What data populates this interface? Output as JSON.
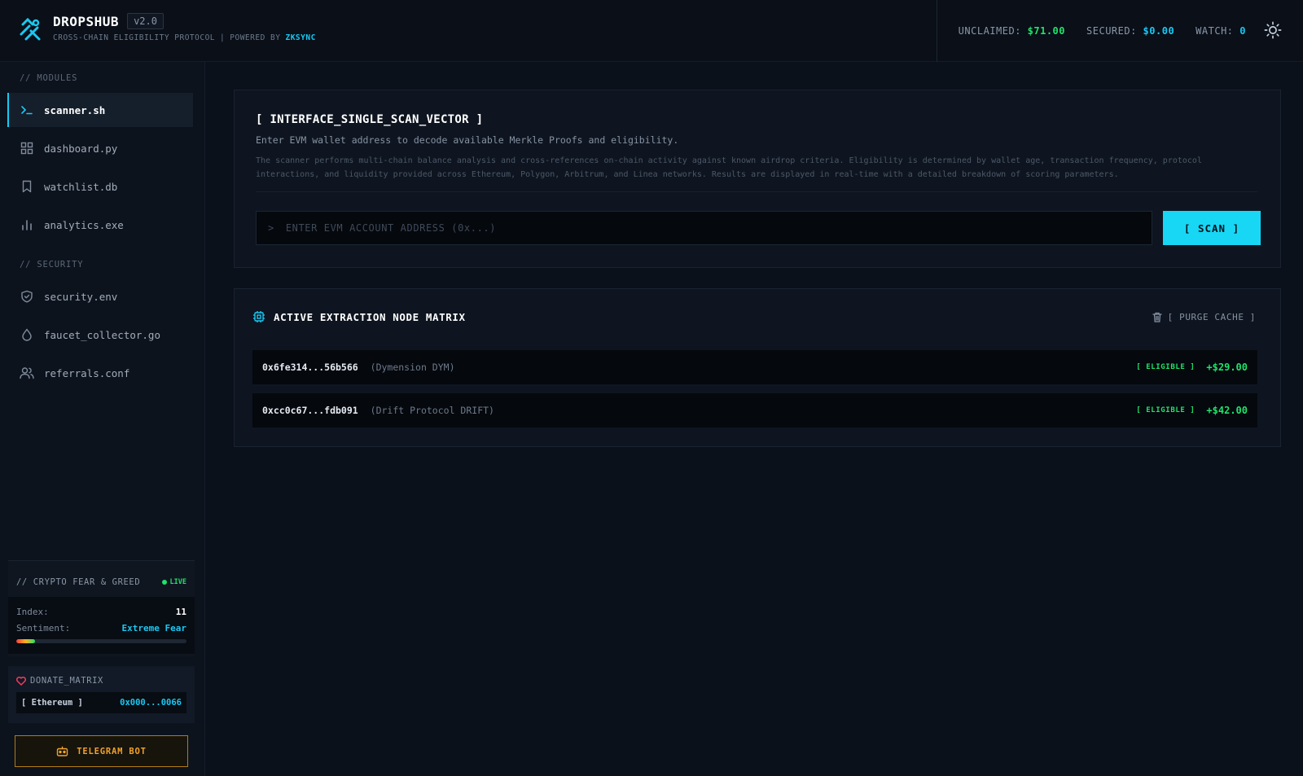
{
  "header": {
    "brand": "DROPSHUB",
    "version": "v2.0",
    "tagline_left": "CROSS-CHAIN ELIGIBILITY PROTOCOL",
    "tagline_sep": "|",
    "tagline_powered": "POWERED BY",
    "tagline_accent": "ZKSYNC",
    "stats": {
      "unclaimed_label": "UNCLAIMED:",
      "unclaimed_value": "$71.00",
      "secured_label": "SECURED:",
      "secured_value": "$0.00",
      "watch_label": "WATCH:",
      "watch_value": "0"
    },
    "theme_icon": "sun-icon"
  },
  "sidebar": {
    "modules_label": "// MODULES",
    "modules": [
      {
        "label": "scanner.sh",
        "icon": "terminal-icon",
        "active": true
      },
      {
        "label": "dashboard.py",
        "icon": "grid-icon",
        "active": false
      },
      {
        "label": "watchlist.db",
        "icon": "bookmark-icon",
        "active": false
      },
      {
        "label": "analytics.exe",
        "icon": "bar-chart-icon",
        "active": false
      }
    ],
    "security_label": "// SECURITY",
    "security": [
      {
        "label": "security.env",
        "icon": "shield-icon"
      },
      {
        "label": "faucet_collector.go",
        "icon": "droplet-icon"
      },
      {
        "label": "referrals.conf",
        "icon": "users-icon"
      }
    ],
    "fear_greed": {
      "title": "// CRYPTO FEAR & GREED",
      "live": "LIVE",
      "index_label": "Index:",
      "index_value": "11",
      "sentiment_label": "Sentiment:",
      "sentiment_value": "Extreme Fear",
      "level": 0.11
    },
    "donate": {
      "title": "DONATE_MATRIX",
      "chain": "[ Ethereum ]",
      "address": "0x000...0066"
    },
    "telegram": "TELEGRAM BOT"
  },
  "scan": {
    "title": "[ INTERFACE_SINGLE_SCAN_VECTOR ]",
    "subtitle": "Enter EVM wallet address to decode available Merkle Proofs and eligibility.",
    "description": "The scanner performs multi-chain balance analysis and cross-references on-chain activity against known airdrop criteria. Eligibility is determined by wallet age, transaction frequency, protocol interactions, and liquidity provided across Ethereum, Polygon, Arbitrum, and Linea networks. Results are displayed in real-time with a detailed breakdown of scoring parameters.",
    "prompt": ">",
    "placeholder": "ENTER EVM ACCOUNT ADDRESS (0x...)",
    "value": "",
    "button": "[ SCAN ]"
  },
  "matrix": {
    "title": "ACTIVE EXTRACTION NODE MATRIX",
    "purge": "[ PURGE CACHE ]",
    "rows": [
      {
        "address": "0x6fe314...56b566",
        "name": "(Dymension DYM)",
        "status": "[ ELIGIBLE ]",
        "amount": "+$29.00"
      },
      {
        "address": "0xcc0c67...fdb091",
        "name": "(Drift Protocol DRIFT)",
        "status": "[ ELIGIBLE ]",
        "amount": "+$42.00"
      }
    ]
  },
  "colors": {
    "accent": "#18c9f2",
    "positive": "#1fe36b",
    "warning": "#f0a22a"
  }
}
